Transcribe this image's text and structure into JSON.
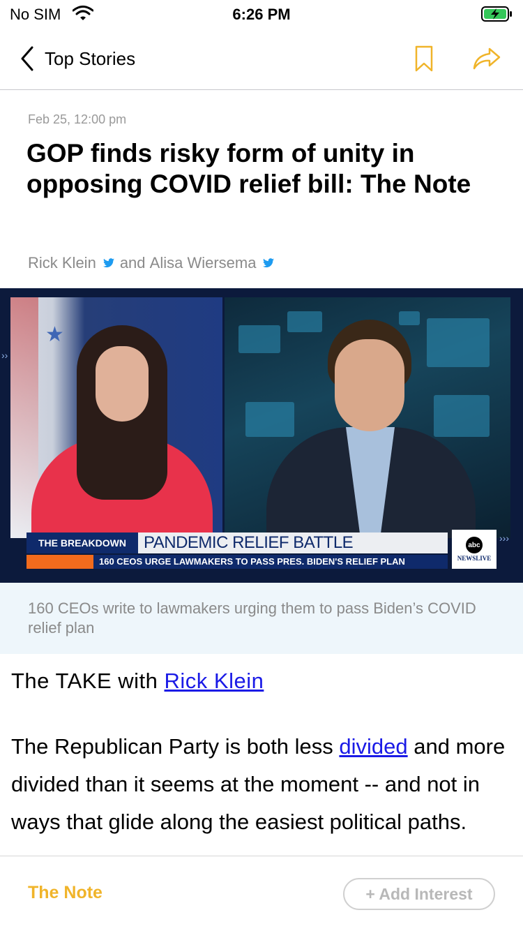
{
  "status_bar": {
    "carrier": "No SIM",
    "time": "6:26 PM"
  },
  "nav": {
    "back_label": "Top Stories",
    "accent_color": "#f0b42a"
  },
  "article": {
    "date": "Feb 25, 12:00 pm",
    "headline": "GOP finds risky form of unity in opposing COVID relief bill: The Note",
    "authors": [
      {
        "name": "Rick Klein",
        "icon": "twitter-icon"
      },
      {
        "name": "Alisa Wiersema",
        "icon": "twitter-icon"
      }
    ],
    "byline_joiner": "and",
    "video": {
      "lower_third_tag": "THE BREAKDOWN",
      "lower_third_title": "PANDEMIC RELIEF BATTLE",
      "lower_third_sub": "160 CEOS URGE LAWMAKERS TO PASS PRES. BIDEN'S RELIEF PLAN",
      "network_logo": "abc",
      "network_label": "NEWSLIVE"
    },
    "caption": "160 CEOs write to lawmakers urging them to pass Biden’s COVID relief plan",
    "take_prefix": "The TAKE with",
    "take_author_link": "Rick Klein",
    "body": {
      "part1": "The Republican Party is both less ",
      "link": "divided",
      "part2": " and more divided than it seems at the moment -- and not in ways that glide along the easiest political paths."
    }
  },
  "bottom_bar": {
    "tag": "The Note",
    "add_interest": "+ Add Interest"
  }
}
